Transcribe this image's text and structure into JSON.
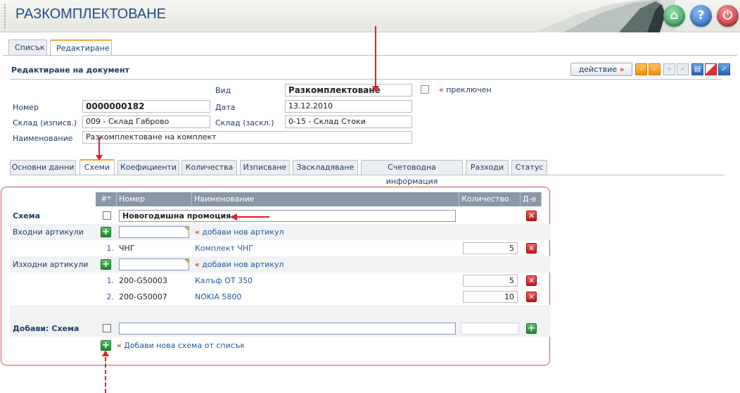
{
  "app": {
    "title": "РАЗКОМПЛЕКТОВАНЕ"
  },
  "top_tabs": [
    {
      "label": "Списък"
    },
    {
      "label": "Редактиране"
    }
  ],
  "doc": {
    "title": "Редактиране на документ",
    "action_label": "действие",
    "action_arrow": "»",
    "type_label": "Вид",
    "type_value": "Разкомплектоване",
    "switched_label": "преключен",
    "number_label": "Номер",
    "number_value": "0000000182",
    "date_label": "Дата",
    "date_value": "13.12.2010",
    "wh_out_label": "Склад (изписв.)",
    "wh_out_value": "009 - Склад Габрово",
    "wh_in_label": "Склад (заскл.)",
    "wh_in_value": "0-15 - Склад Стоки",
    "name_label": "Наименование",
    "name_value": "Разкомплектоване на комплект"
  },
  "sub_tabs": [
    {
      "label": "Основни данни"
    },
    {
      "label": "Схеми"
    },
    {
      "label": "Коефициенти"
    },
    {
      "label": "Количества"
    },
    {
      "label": "Изписване"
    },
    {
      "label": "Заскладяване"
    },
    {
      "label": "Счетоводна информация"
    },
    {
      "label": "Разходи"
    },
    {
      "label": "Статус"
    }
  ],
  "grid": {
    "columns": {
      "num": "#*",
      "code": "Номер",
      "name": "Наименование",
      "qty": "Количество",
      "del": "Д-е"
    },
    "scheme_label": "Схема",
    "scheme_name": "Новогодишна промоция",
    "input_label": "Входни артикули",
    "output_label": "Изходни артикули",
    "add_article": "добави нов артикул",
    "inputs": [
      {
        "num": "1.",
        "code": "ЧНГ",
        "name": "Комплект ЧНГ",
        "qty": "5"
      }
    ],
    "outputs": [
      {
        "num": "1.",
        "code": "200-G50003",
        "name": "Калъф ОТ 350",
        "qty": "5"
      },
      {
        "num": "2.",
        "code": "200-G50007",
        "name": "NOKIA 5800",
        "qty": "10"
      }
    ],
    "add_scheme_label": "Добави: Схема",
    "add_from_list": "Добави нова схема от списък",
    "laquo": "«"
  },
  "colors": {
    "accent": "#f0a83a",
    "highlight": "#e02020",
    "header": "#8a97a8"
  }
}
